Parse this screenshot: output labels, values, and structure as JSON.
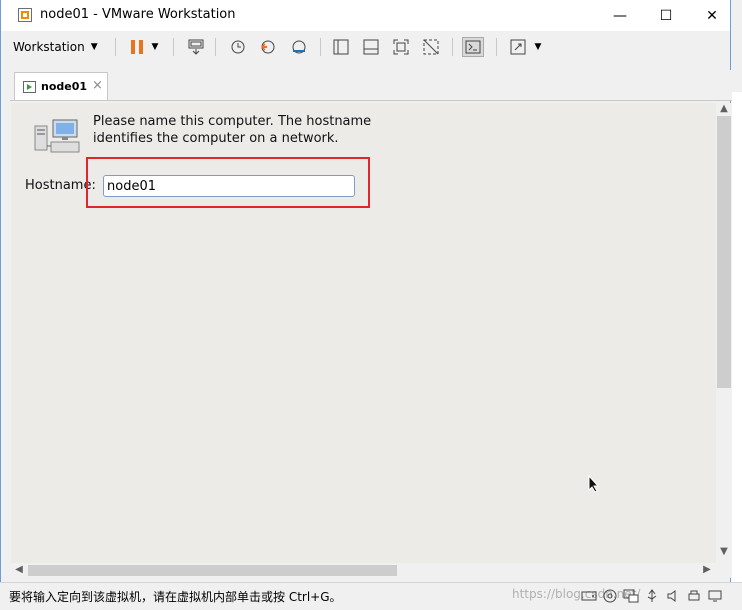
{
  "window": {
    "title": "node01 - VMware Workstation",
    "minimize_glyph": "—",
    "maximize_glyph": "☐",
    "close_glyph": "✕"
  },
  "toolbar": {
    "workstation_menu": "Workstation",
    "icons": [
      "pause-icon",
      "send-keys-icon",
      "snapshot-icon",
      "revert-snapshot-icon",
      "snapshot-manager-icon",
      "library-view-icon",
      "thumbnail-view-icon",
      "fullscreen-icon",
      "unity-icon",
      "console-view-icon",
      "stretch-view-icon"
    ]
  },
  "tabs": [
    {
      "label": "node01",
      "close": "×"
    }
  ],
  "guest": {
    "prompt": "Please name this computer.  The hostname identifies the computer on a network.",
    "hostname_label": "Hostname:",
    "hostname_value": "node01"
  },
  "statusbar": {
    "message": "要将输入定向到该虚拟机，请在虚拟机内部单击或按 Ctrl+G。",
    "watermark": "https://blog.csdn.net/",
    "device_icons": [
      "hard-disk-icon",
      "cd-dvd-icon",
      "network-adapter-icon",
      "usb-icon",
      "sound-icon",
      "printer-icon",
      "display-icon"
    ]
  },
  "colors": {
    "highlight": "#e0252b",
    "pause": "#e8741e"
  }
}
